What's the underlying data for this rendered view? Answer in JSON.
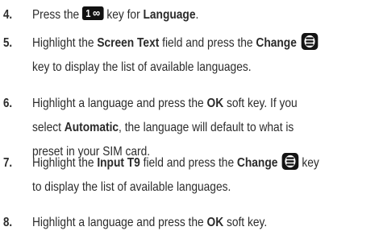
{
  "steps": [
    {
      "number": "4.",
      "lines": [
        [
          "Press the ",
          {
            "key": "1",
            "glyph": "∞"
          },
          " key for ",
          {
            "b": "Language"
          },
          "."
        ]
      ]
    },
    {
      "number": "5.",
      "lines": [
        [
          "Highlight the ",
          {
            "b": "Screen Text"
          },
          " field and press the ",
          {
            "b": "Change"
          },
          " ",
          {
            "icon": "nav-key"
          }
        ],
        [
          "key to display the list of available languages."
        ]
      ]
    },
    {
      "number": "6.",
      "lines": [
        [
          "Highlight a language and press the ",
          {
            "b": "OK"
          },
          " soft key. If you"
        ],
        [
          "select ",
          {
            "b": "Automatic"
          },
          ", the language will default to what is"
        ],
        [
          "preset in your SIM card."
        ]
      ]
    },
    {
      "number": "7.",
      "lines": [
        [
          "Highlight the ",
          {
            "b": "Input T9"
          },
          " field and press the ",
          {
            "b": "Change"
          },
          " ",
          {
            "icon": "nav-key"
          },
          " key"
        ],
        [
          "to display the list of available languages."
        ]
      ]
    },
    {
      "number": "8.",
      "lines": [
        [
          "Highlight a language and press the ",
          {
            "b": "OK"
          },
          " soft key."
        ]
      ]
    }
  ]
}
